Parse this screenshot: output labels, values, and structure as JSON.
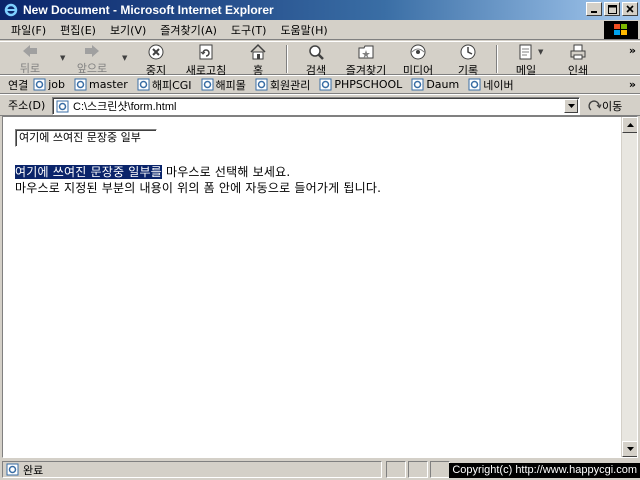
{
  "window": {
    "title": "New Document - Microsoft Internet Explorer"
  },
  "menu": [
    "파일(F)",
    "편집(E)",
    "보기(V)",
    "즐겨찾기(A)",
    "도구(T)",
    "도움말(H)"
  ],
  "toolbar": {
    "back": "뒤로",
    "forward": "앞으로",
    "stop": "중지",
    "refresh": "새로고침",
    "home": "홈",
    "search": "검색",
    "favorites": "즐겨찾기",
    "media": "미디어",
    "history": "기록",
    "mail": "메일",
    "print": "인쇄"
  },
  "links": {
    "lead": "연결",
    "items": [
      "job",
      "master",
      "해피CGI",
      "해피몰",
      "회원관리",
      "PHPSCHOOL",
      "Daum",
      "네이버"
    ]
  },
  "address": {
    "lead": "주소(D)",
    "value": "C:\\스크린샷\\form.html",
    "go": "이동"
  },
  "page": {
    "input_value": "여기에 쓰여진 문장중 일부",
    "selected_text": "여기에 쓰여진 문장중 일부를",
    "line1_rest": " 마우스로 선택해 보세요.",
    "line2": "마우스로 지정된 부분의 내용이 위의 폼 안에 자동으로 들어가게 됩니다."
  },
  "status": {
    "text": "완료",
    "copyright": "Copyright(c) http://www.happycgi.com"
  },
  "colors": {
    "titlebar": "#0a246a",
    "selection": "#0a246a",
    "chrome": "#d4d0c8"
  }
}
